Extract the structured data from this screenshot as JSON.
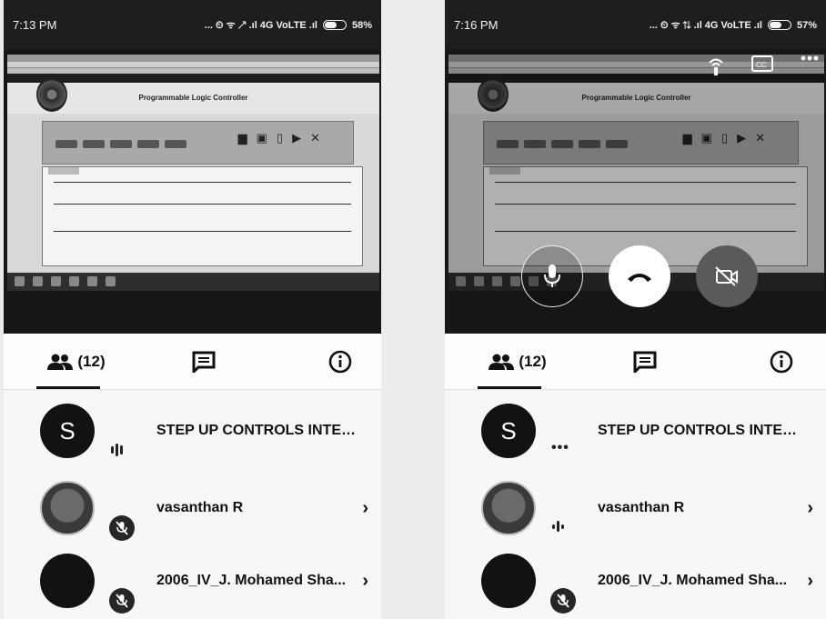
{
  "screens": [
    {
      "status": {
        "time": "7:13 PM",
        "indicators": "... ⏲ ᯤ ↗ .ıl 4G VoLTE .ıl",
        "battery": "58%",
        "battery_level": 0.58
      },
      "shared_screen": {
        "site_title": "Programmable Logic Controller"
      },
      "people_count": "(12)",
      "participants": [
        {
          "initial": "S",
          "name": "STEP UP CONTROLS INTERN / I...",
          "status": "speaking"
        },
        {
          "initial": "",
          "name": "vasanthan R",
          "status": "muted",
          "chevron": "›"
        },
        {
          "initial": "",
          "name": "2006_IV_J. Mohamed Sha...",
          "status": "muted",
          "chevron": "›"
        }
      ]
    },
    {
      "status": {
        "time": "7:16 PM",
        "indicators": "... ⏲ ᯤ ⇅ .ıl 4G VoLTE .ıl",
        "battery": "57%",
        "battery_level": 0.57
      },
      "shared_screen": {
        "site_title": "Programmable Logic Controller"
      },
      "people_count": "(12)",
      "participants": [
        {
          "initial": "S",
          "name": "STEP UP CONTROLS INTERN / I...",
          "status": "idle"
        },
        {
          "initial": "",
          "name": "vasanthan R",
          "status": "speaking",
          "chevron": "›"
        },
        {
          "initial": "",
          "name": "2006_IV_J. Mohamed Sha...",
          "status": "muted",
          "chevron": "›"
        }
      ]
    }
  ],
  "icons": {
    "people": "people-icon",
    "chat": "chat-icon",
    "info": "info-icon",
    "mic": "microphone-icon",
    "end_call": "end-call-icon",
    "camera_off": "camera-off-icon",
    "mic_off": "mic-off-icon",
    "audio_level": "audio-level-icon",
    "captions": "captions-icon",
    "more": "more-options-icon",
    "cast": "speaker-icon"
  }
}
